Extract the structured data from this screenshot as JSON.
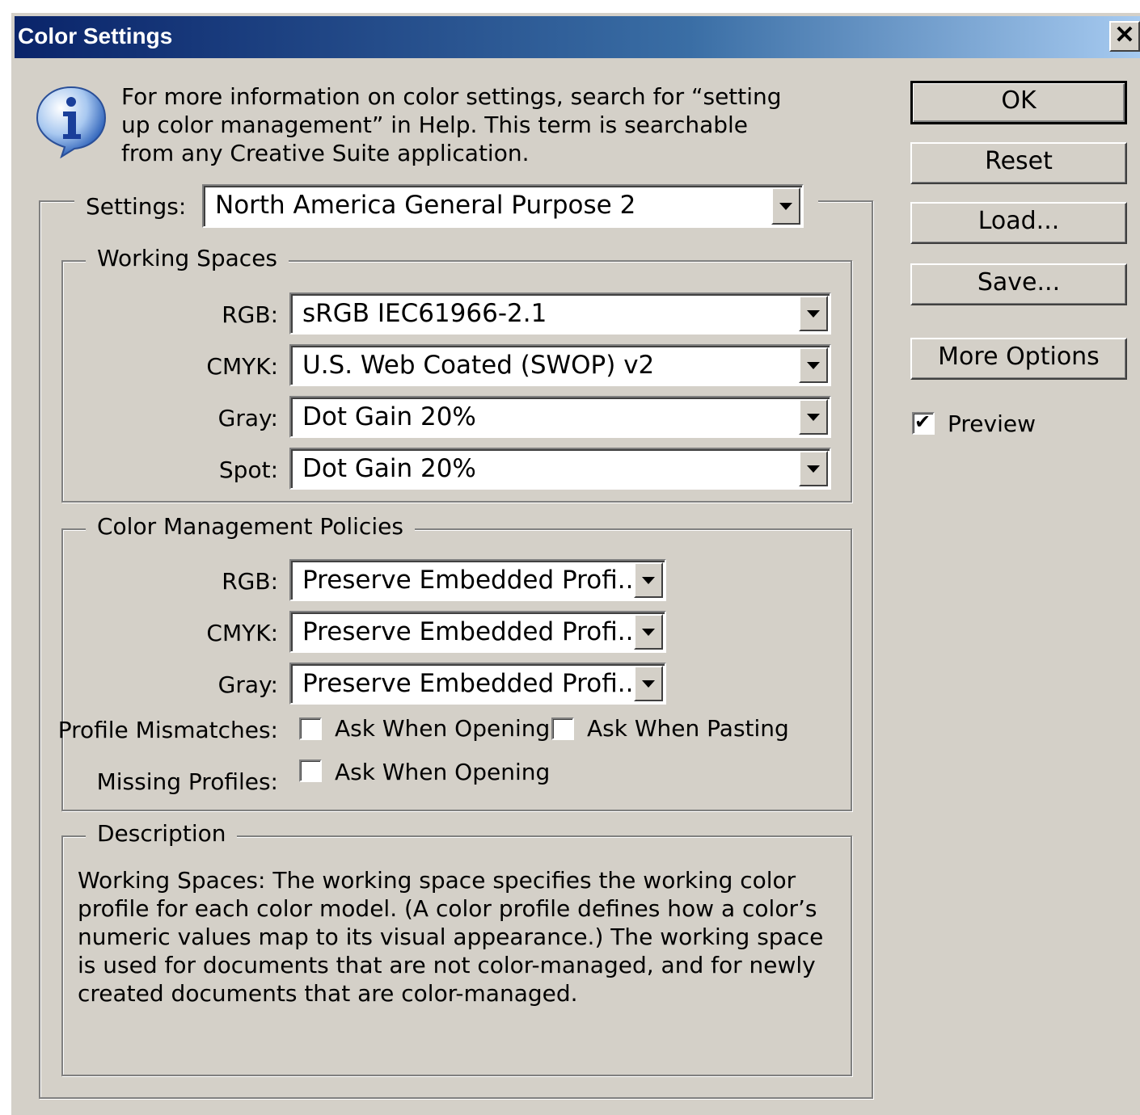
{
  "window": {
    "title": "Color Settings",
    "close_symbol": "✕"
  },
  "info": {
    "icon": "info-icon",
    "text": "For more information on color settings, search for “setting up color management” in Help. This term is searchable from any Creative Suite application."
  },
  "settings": {
    "label": "Settings:",
    "value": "North America General Purpose 2"
  },
  "working_spaces": {
    "legend": "Working Spaces",
    "rgb": {
      "label": "RGB:",
      "value": "sRGB IEC61966-2.1"
    },
    "cmyk": {
      "label": "CMYK:",
      "value": "U.S. Web Coated (SWOP) v2"
    },
    "gray": {
      "label": "Gray:",
      "value": "Dot Gain 20%"
    },
    "spot": {
      "label": "Spot:",
      "value": "Dot Gain 20%"
    }
  },
  "policies": {
    "legend": "Color Management Policies",
    "rgb": {
      "label": "RGB:",
      "value": "Preserve Embedded Profi..."
    },
    "cmyk": {
      "label": "CMYK:",
      "value": "Preserve Embedded Profi..."
    },
    "gray": {
      "label": "Gray:",
      "value": "Preserve Embedded Profi..."
    },
    "profile_mismatches": {
      "label": "Profile Mismatches:",
      "ask_when_opening": {
        "label": "Ask When Opening",
        "checked": false
      },
      "ask_when_pasting": {
        "label": "Ask When Pasting",
        "checked": false
      }
    },
    "missing_profiles": {
      "label": "Missing Profiles:",
      "ask_when_opening": {
        "label": "Ask When Opening",
        "checked": false
      }
    }
  },
  "description": {
    "legend": "Description",
    "text": "Working Spaces:  The working space specifies the working color profile for each color model.  (A color profile defines how a color’s numeric values map to its visual appearance.)  The working space is used for documents that are not color-managed, and for newly created documents that are color-managed."
  },
  "buttons": {
    "ok": "OK",
    "reset": "Reset",
    "load": "Load...",
    "save": "Save...",
    "more_options": "More Options"
  },
  "preview": {
    "label": "Preview",
    "checked": true
  }
}
